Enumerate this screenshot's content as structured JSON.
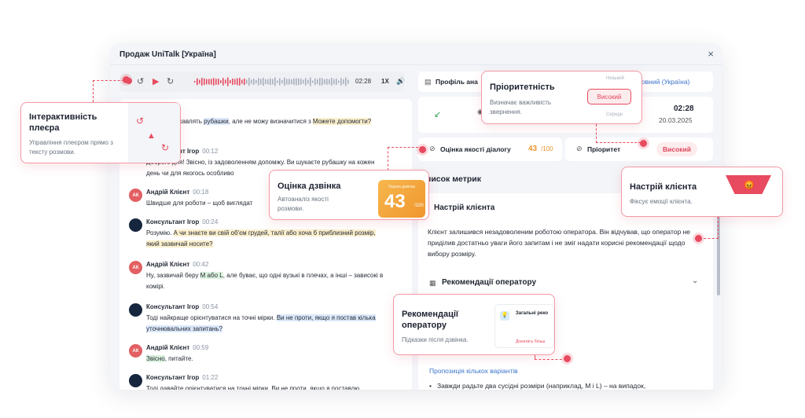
{
  "window": {
    "title": "Продаж UniTalk [Україна]",
    "close": "×"
  },
  "player": {
    "time": "02:28",
    "speed": "1X",
    "icons": [
      "record-dot",
      "rewind-icon",
      "play-icon",
      "forward-icon",
      "volume-icon"
    ]
  },
  "messages": [
    {
      "name": "",
      "time": "00:05",
      "role": "client",
      "parts": [
        {
          "t": "ня! Мене цікавлять "
        },
        {
          "t": "рубашки",
          "h": "b"
        },
        {
          "t": ", але не можу визначитися з "
        },
        {
          "t": "Можете допомогти?",
          "h": "y"
        }
      ]
    },
    {
      "name": "Консультант Ігор",
      "time": "00:12",
      "role": "op",
      "parts": [
        {
          "t": "Доброго дня! Звісно, із задоволенням допомжу. Ви шукаєте рубашку на кожен день чи для якогось особливо"
        }
      ]
    },
    {
      "name": "Андрій Клієнт",
      "time": "00:18",
      "role": "client",
      "parts": [
        {
          "t": "Швидше для роботи – щоб виглядат"
        }
      ]
    },
    {
      "name": "Консультант Ігор",
      "time": "00:24",
      "role": "op",
      "parts": [
        {
          "t": "Розумію. "
        },
        {
          "t": "А чи знаєте ви свій об'єм грудей, талії або хоча б приблизний розмір, який зазвичай носите?",
          "h": "y"
        }
      ]
    },
    {
      "name": "Андрій Клієнт",
      "time": "00:42",
      "role": "client",
      "parts": [
        {
          "t": "Ну, зазвичай беру "
        },
        {
          "t": "M або L",
          "h": "g"
        },
        {
          "t": ", але буває, що одні вузькі в плечах, а інші – зависокі в комірі."
        }
      ]
    },
    {
      "name": "Консультант Ігор",
      "time": "00:54",
      "role": "op",
      "parts": [
        {
          "t": "Тоді найкраще орієнтуватися на точні мірки. "
        },
        {
          "t": "Ви не проти, якщо я постав кілька уточнювальних запитань?",
          "h": "b"
        }
      ]
    },
    {
      "name": "Андрій Клієнт",
      "time": "00:59",
      "role": "client",
      "parts": [
        {
          "t": "Звісно",
          "h": "g"
        },
        {
          "t": ", питайте."
        }
      ]
    },
    {
      "name": "Консультант Ігор",
      "time": "01:22",
      "role": "op",
      "parts": [
        {
          "t": "Тоді давайте орієнтуватися на точні мірки. Ви не проти, якщо я поставлю"
        }
      ]
    }
  ],
  "avatar_initials": "АК",
  "right": {
    "profile_label": "Профіль ана",
    "profile_value": "сновний (Україна)",
    "call_time": "02:28",
    "call_date": "20.03.2025",
    "quality_label": "Оцінка якості діалогу",
    "quality_score": "43",
    "quality_max": "/100",
    "priority_label": "Пріоритет",
    "priority_value": "Високий",
    "metrics_heading": "писок метрик",
    "mood_section": "Настрій клієнта",
    "mood_text": "Клієнт залишився незадоволеним роботою оператора. Він відчував, що оператор не приділив достатньо уваги його запитам і не зміг надати корисні рекомендації щодо вибору розміру.",
    "rec_section": "Рекомендації оператору",
    "rec_link": "Пропозиція кількох варіантів",
    "rec_bullet": "Завжди радьте два сусідні розміри (наприклад, M і L) – на випадок,"
  },
  "callouts": {
    "player": {
      "title": "Інтерактивність плеєра",
      "desc": "Управління плеєром прямо з тексту розмови."
    },
    "score": {
      "title": "Оцінка дзвінка",
      "desc": "Автоаналіз якості розмови.",
      "badge_label": "Оцінка дзвінка",
      "badge_num": "43",
      "badge_den": "/100"
    },
    "priority": {
      "title": "Пріоритетність",
      "desc": "Визначає важливість звернення.",
      "chip_high": "Високий",
      "chip_low": "Низький",
      "chip_mid": "Середн"
    },
    "mood": {
      "title": "Настрій клієнта",
      "desc": "Фіксує емоції клієнта."
    },
    "rec": {
      "title": "Рекомендації оператору",
      "desc": "Підказки після дзвінка.",
      "mini_title": "Загальні реко",
      "mini_link": "Дізнатись більш"
    }
  },
  "colors": {
    "accent": "#e84a5f",
    "link": "#3a74c9",
    "score": "#f0962e"
  }
}
